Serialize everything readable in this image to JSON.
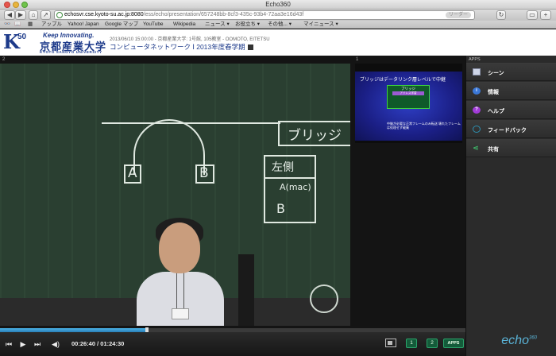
{
  "window": {
    "title": "Echo360"
  },
  "toolbar": {
    "url_host": "echosvr.cse.kyoto-su.ac.jp:8080",
    "url_path": "/ess/echo/presentation/657248bb-8cf3-435c-93b4-72aa3e16d43f",
    "reader_label": "リーダー"
  },
  "bookmarks": [
    "アップル",
    "Yahoo! Japan",
    "Google マップ",
    "YouTube",
    "Wikipedia",
    "ニュース ▾",
    "お役立ち ▾",
    "その他... ▾",
    "マイニュース ▾"
  ],
  "header": {
    "logo_k": "K",
    "logo_50": "50",
    "tagline": "Keep Innovating.",
    "university_jp": "京都産業大学",
    "university_en": "KYOTO SANGYO UNIVERSITY",
    "meta": "2013/06/10 15:00:00 - 京都産業大学: 1号館, 105教室 - OOMOTO, EITETSU",
    "course_title": "コンピュータネットワーク Ⅰ 2013年度春学期"
  },
  "video_left": {
    "label": "2",
    "chalk_bridge": "ブリッジ",
    "chalk_A": "A",
    "chalk_B": "B",
    "chalk_left_side": "左側",
    "chalk_amac": "A(mac)",
    "chalk_b2": "B"
  },
  "video_right": {
    "label": "1",
    "slide_title": "ブリッジはデータリンク層レベルで中継",
    "slide_bridge": "ブリッジ",
    "slide_purple": "アドレス学習",
    "slide_note": "中継が必要な正常フレームのみ転送 壊れたフレームは処理せず破棄"
  },
  "apps": {
    "label": "APPS",
    "items": [
      {
        "label": "シーン",
        "icon": "screen-icon"
      },
      {
        "label": "情報",
        "icon": "info-icon"
      },
      {
        "label": "ヘルプ",
        "icon": "help-icon"
      },
      {
        "label": "フィードバック",
        "icon": "feedback-icon"
      },
      {
        "label": "共有",
        "icon": "share-icon"
      }
    ],
    "echo_logo": "echo",
    "echo_sup": "360"
  },
  "player": {
    "current_time": "00:26:40",
    "total_time": "01:24:30",
    "timecode": "00:26:40 / 01:24:30",
    "progress": 0.316,
    "stream1": "1",
    "stream2": "2",
    "apps_button": "APPS"
  }
}
